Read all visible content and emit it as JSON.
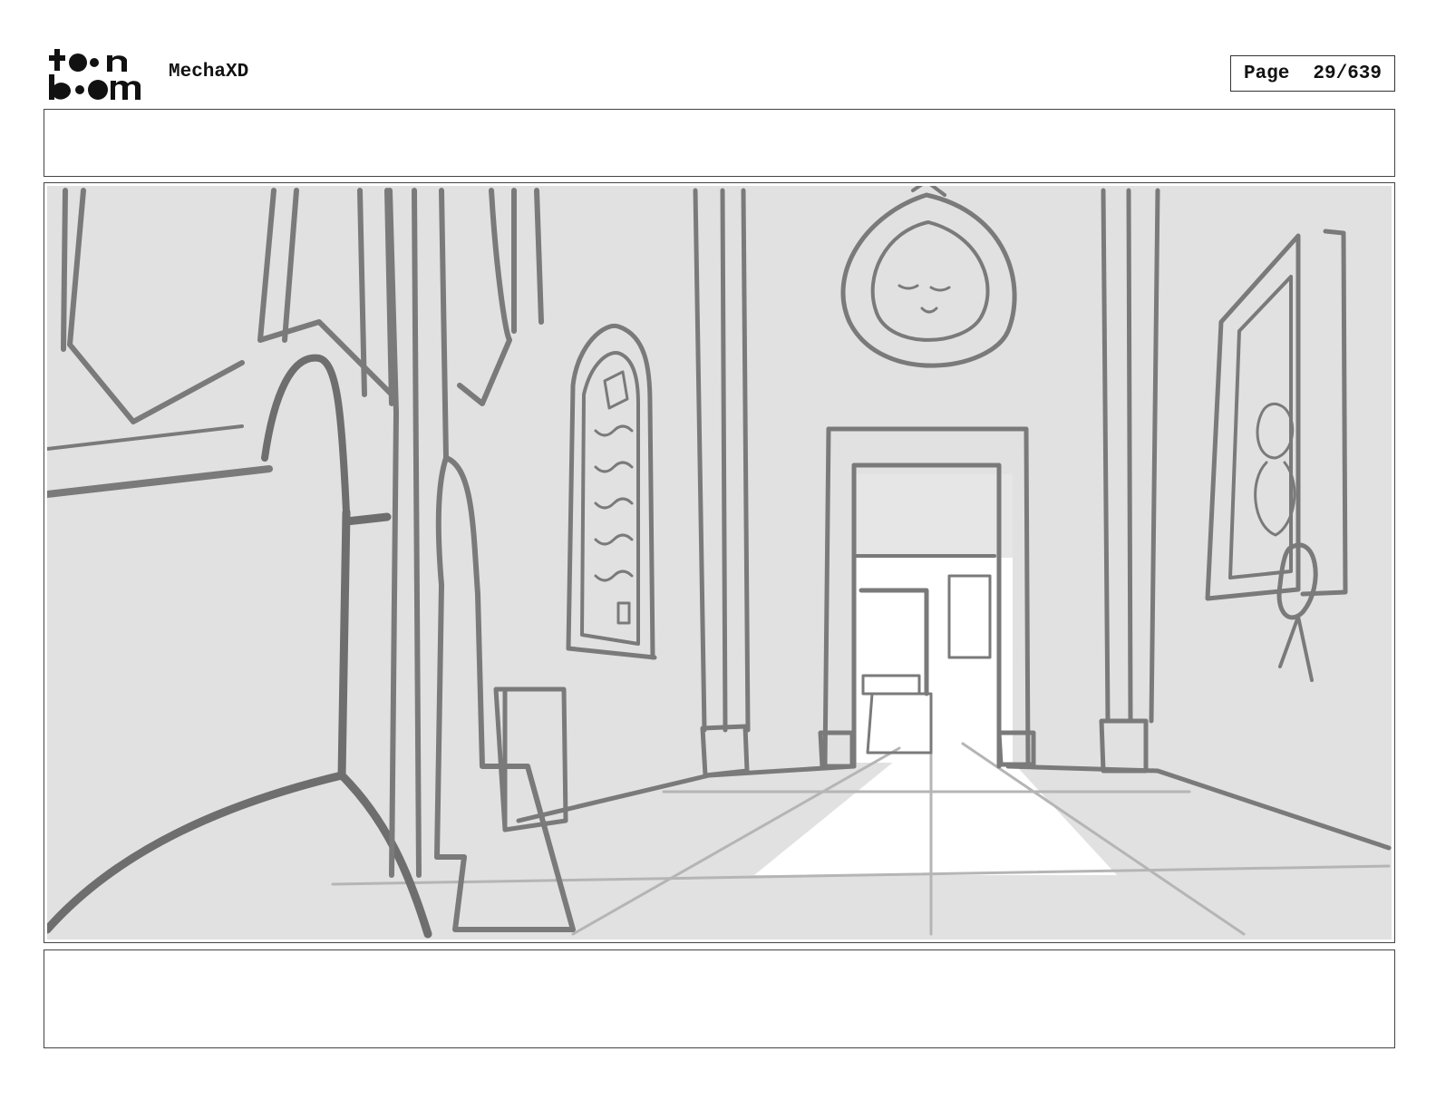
{
  "header": {
    "logo_text_top": "to•n",
    "logo_text_bottom": "b•om",
    "project_name": "MechaXD",
    "page_label": "Page",
    "page_number": "29/639"
  },
  "panel": {
    "caption": "",
    "notes": "",
    "scene_description_icons": [
      "hallway-sketch"
    ]
  },
  "colors": {
    "ink": "#7a7a7a",
    "background_gray": "#e1e1e1",
    "floor_light": "#ffffff",
    "border": "#444444"
  }
}
